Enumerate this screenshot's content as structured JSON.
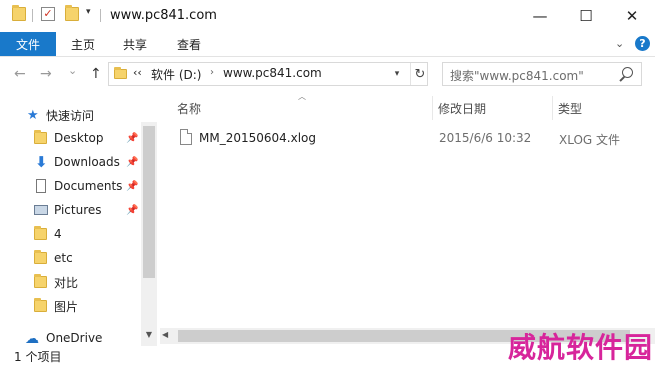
{
  "window": {
    "title": "www.pc841.com",
    "minimize": "—",
    "maximize": "☐",
    "close": "✕"
  },
  "quick_access_toolbar": {
    "dropdown": "▾"
  },
  "ribbon": {
    "tabs": [
      "文件",
      "主页",
      "共享",
      "查看"
    ],
    "chevron": "⌄",
    "help": "?"
  },
  "nav_buttons": {
    "back": "←",
    "forward": "→",
    "recent": "⌄",
    "up": "↑"
  },
  "address": {
    "crumbs": [
      "‹‹",
      "软件 (D:)",
      "www.pc841.com"
    ],
    "separator": "›",
    "dropdown": "▾",
    "refresh": "↻"
  },
  "search": {
    "placeholder": "搜索\"www.pc841.com\""
  },
  "navigation_pane": {
    "quick_access_label": "快速访问",
    "items": [
      {
        "label": "Desktop",
        "icon": "desktop-folder-icon",
        "pinned": true
      },
      {
        "label": "Downloads",
        "icon": "downloads-icon",
        "pinned": true
      },
      {
        "label": "Documents",
        "icon": "documents-icon",
        "pinned": true
      },
      {
        "label": "Pictures",
        "icon": "pictures-icon",
        "pinned": true
      },
      {
        "label": "4",
        "icon": "folder-icon",
        "pinned": false
      },
      {
        "label": "etc",
        "icon": "folder-icon",
        "pinned": false
      },
      {
        "label": "对比",
        "icon": "folder-icon",
        "pinned": false
      },
      {
        "label": "图片",
        "icon": "folder-icon",
        "pinned": false
      }
    ],
    "onedrive_label": "OneDrive",
    "pin_glyph": "📌"
  },
  "file_list": {
    "columns": [
      "名称",
      "修改日期",
      "类型"
    ],
    "rows": [
      {
        "name": "MM_20150604.xlog",
        "modified": "2015/6/6 10:32",
        "type": "XLOG 文件"
      }
    ]
  },
  "status_bar": {
    "text": "1 个项目"
  },
  "watermark": {
    "text": "威航软件园",
    "color": "#d7259b"
  },
  "colors": {
    "accent": "#1979ca",
    "folder": "#f6d36b"
  }
}
